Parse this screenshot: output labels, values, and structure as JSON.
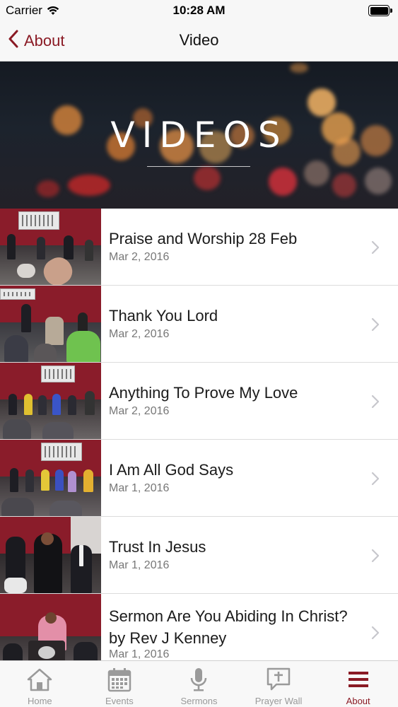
{
  "status_bar": {
    "carrier": "Carrier",
    "time": "10:28 AM"
  },
  "nav": {
    "back_label": "About",
    "title": "Video"
  },
  "hero": {
    "title": "VIDEOS"
  },
  "videos": [
    {
      "title": "Praise and Worship 28 Feb",
      "date": "Mar 2, 2016"
    },
    {
      "title": "Thank You Lord",
      "date": "Mar 2, 2016"
    },
    {
      "title": "Anything To Prove My Love",
      "date": "Mar 2, 2016"
    },
    {
      "title": "I Am All God Says",
      "date": "Mar 1, 2016"
    },
    {
      "title": "Trust In Jesus",
      "date": "Mar 1, 2016"
    },
    {
      "title": "Sermon Are You Abiding In Christ?  by Rev J Kenney",
      "date": "Mar 1, 2016"
    }
  ],
  "tabs": [
    {
      "label": "Home",
      "icon": "home-icon",
      "active": false
    },
    {
      "label": "Events",
      "icon": "calendar-icon",
      "active": false
    },
    {
      "label": "Sermons",
      "icon": "microphone-icon",
      "active": false
    },
    {
      "label": "Prayer Wall",
      "icon": "prayer-bubble-icon",
      "active": false
    },
    {
      "label": "About",
      "icon": "menu-icon",
      "active": true
    }
  ],
  "colors": {
    "accent": "#8a1a24",
    "tab_inactive": "#999999",
    "wall": "#8c1c2c"
  }
}
